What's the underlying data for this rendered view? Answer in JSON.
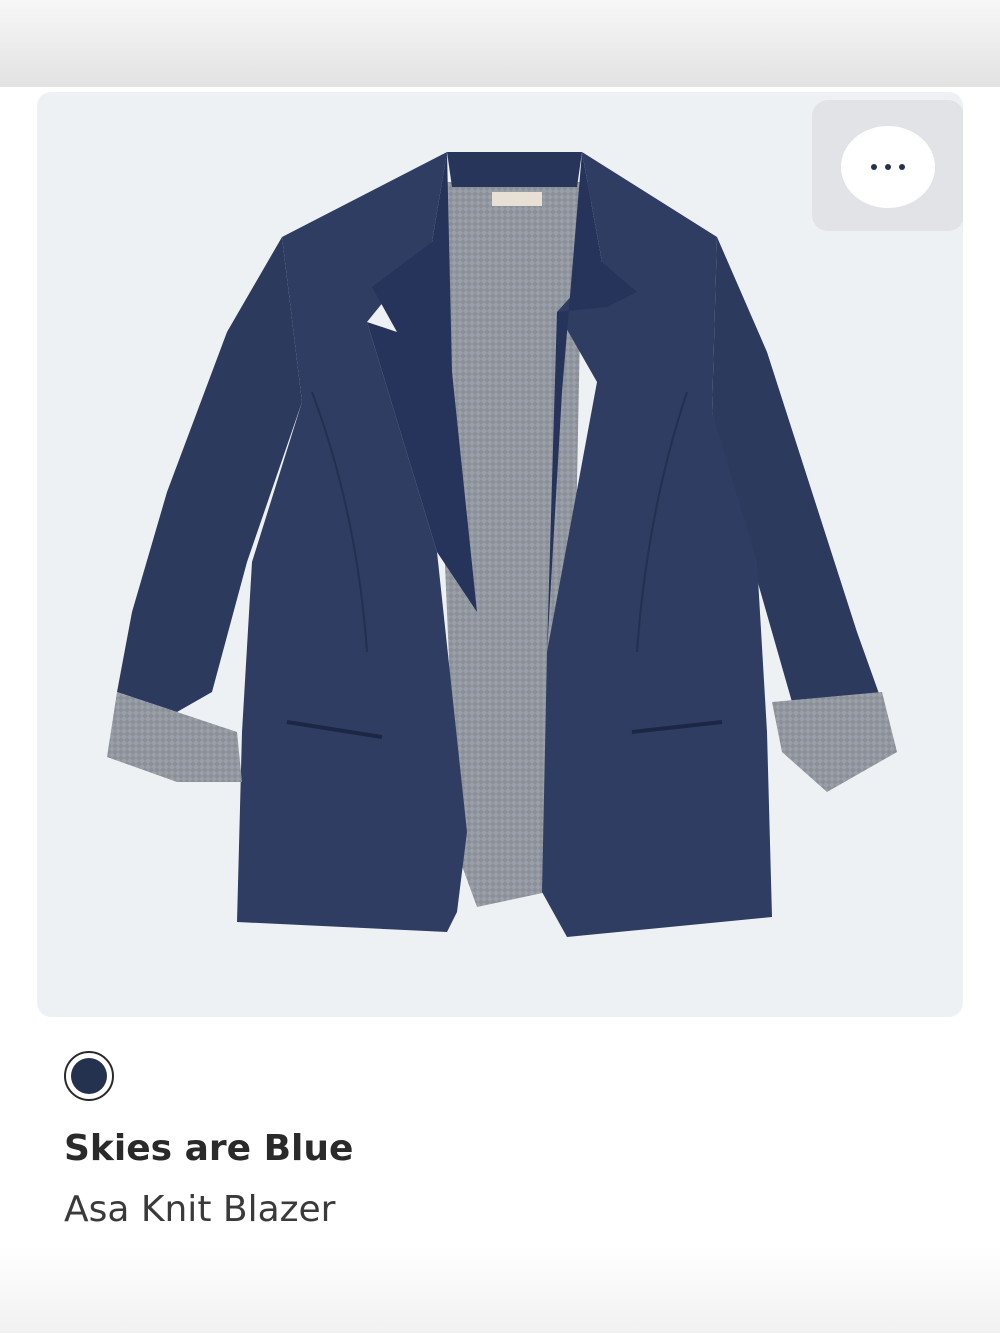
{
  "product": {
    "brand": "Skies are Blue",
    "name": "Asa Knit Blazer",
    "image_icon": "navy-knit-blazer-photo"
  },
  "swatch": {
    "color": "#25324f",
    "selected": true
  },
  "actions": {
    "more_icon": "more-options-icon"
  },
  "colors": {
    "card_background": "#eef1f3",
    "blazer_navy": "#2c3a5e",
    "lining_gray": "#8a8f98"
  }
}
